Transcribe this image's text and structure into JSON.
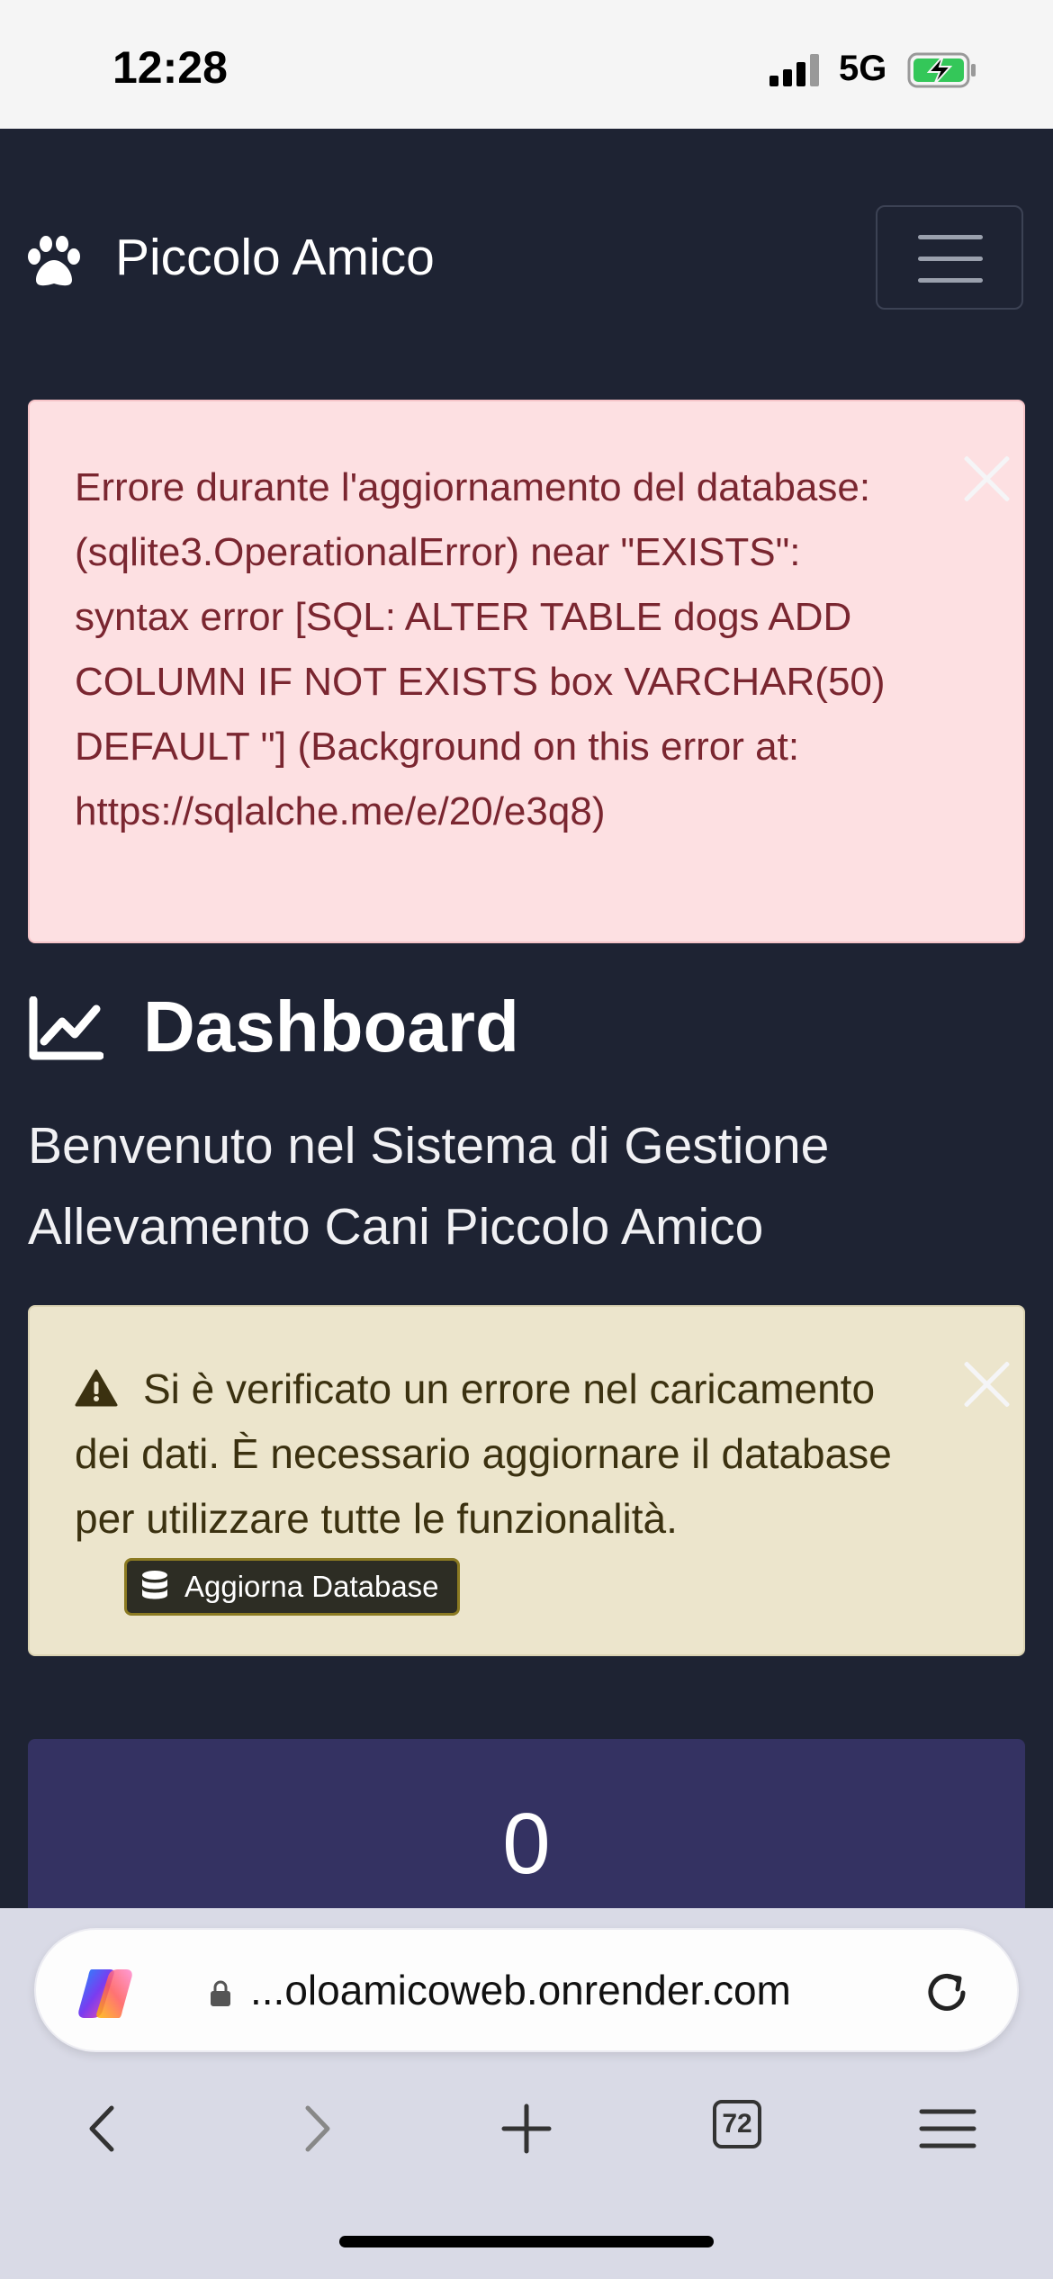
{
  "status_bar": {
    "time": "12:28",
    "network": "5G"
  },
  "navbar": {
    "brand": "Piccolo Amico",
    "brand_icon": "paw-icon",
    "menu_icon": "hamburger-icon"
  },
  "alerts": {
    "error": {
      "message": "Errore durante l'aggiornamento del database: (sqlite3.OperationalError) near \"EXISTS\": syntax error [SQL: ALTER TABLE dogs ADD COLUMN IF NOT EXISTS box VARCHAR(50) DEFAULT ''] (Background on this error at: https://sqlalche.me/e/20/e3q8)",
      "color": "#fde0e2"
    },
    "warning": {
      "message": "Si è verificato un errore nel caricamento dei dati. È necessario aggiornare il database per utilizzare tutte le funzionalità.",
      "button_label": "Aggiorna Database",
      "color": "#ece5cc"
    }
  },
  "dashboard": {
    "title": "Dashboard",
    "title_icon": "chart-line-icon",
    "welcome": "Benvenuto nel Sistema di Gestione Allevamento Cani Piccolo Amico",
    "stat_value": "0",
    "stat_color": "#343262"
  },
  "browser": {
    "url": "...oloamicoweb.onrender.com",
    "tabs_count": "72"
  }
}
